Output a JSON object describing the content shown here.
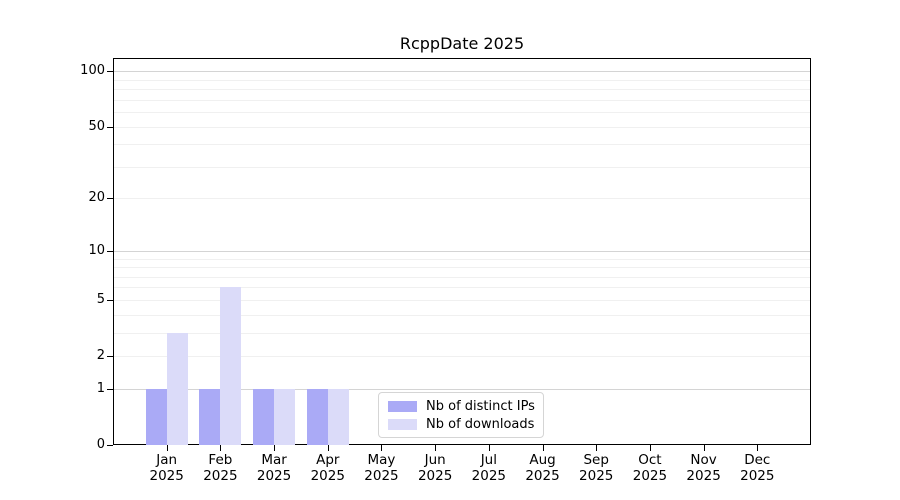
{
  "chart_data": {
    "type": "bar",
    "title": "RcppDate 2025",
    "categories": [
      "Jan",
      "Feb",
      "Mar",
      "Apr",
      "May",
      "Jun",
      "Jul",
      "Aug",
      "Sep",
      "Oct",
      "Nov",
      "Dec"
    ],
    "x_year_label": "2025",
    "series": [
      {
        "name": "Nb of distinct IPs",
        "color": "#aaaaf6",
        "values": [
          1,
          1,
          1,
          1,
          0,
          0,
          0,
          0,
          0,
          0,
          0,
          0
        ]
      },
      {
        "name": "Nb of downloads",
        "color": "#dbdbf9",
        "values": [
          3,
          6,
          1,
          1,
          0,
          0,
          0,
          0,
          0,
          0,
          0,
          0
        ]
      }
    ],
    "yscale": "log1p",
    "ylim": [
      0,
      118
    ],
    "ytick_values": [
      0,
      1,
      2,
      5,
      10,
      20,
      50,
      100
    ],
    "ytick_labels": [
      "0",
      "1",
      "2",
      "5",
      "10",
      "20",
      "50",
      "100"
    ],
    "grid_values": [
      1,
      2,
      3,
      4,
      5,
      6,
      7,
      8,
      9,
      10,
      20,
      30,
      40,
      50,
      60,
      70,
      80,
      90,
      100
    ],
    "grid_major_values": [
      1,
      10,
      100
    ],
    "grid_on": true,
    "legend_position": "inside-bottom-center",
    "colors": {
      "background": "#ffffff",
      "axis": "#000000",
      "text": "#000000",
      "grid_minor": "#f0f0f0",
      "grid_major": "#d4d4d4",
      "legend_border": "#d5d5d5",
      "bar_distinct_ips": "#aaaaf6",
      "bar_downloads": "#dbdbf9"
    }
  }
}
